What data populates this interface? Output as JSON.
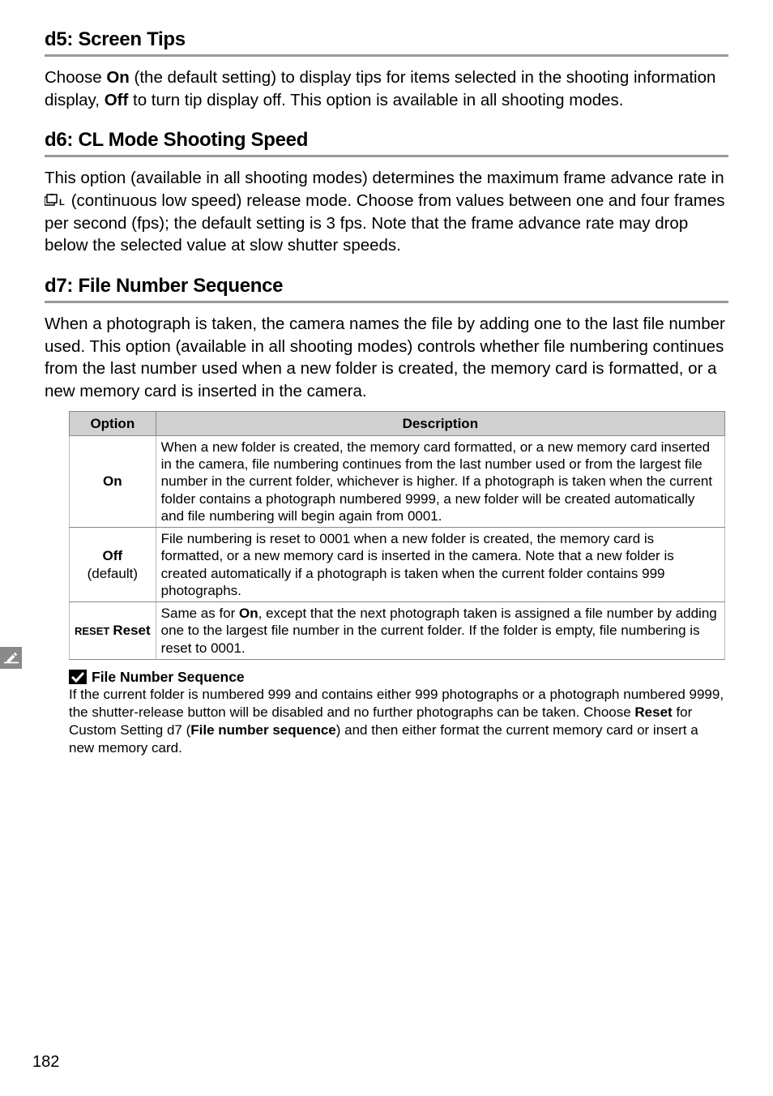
{
  "d5": {
    "heading": "d5: Screen Tips",
    "body_html": "Choose <b>On</b> (the default setting) to display tips for items selected in the shooting information display, <b>Off</b> to turn tip display off.  This option is available in all shooting modes."
  },
  "d6": {
    "heading": "d6: CL Mode Shooting Speed",
    "body_pre": "This option (available in all shooting modes) determines the maximum frame advance rate in ",
    "body_post": " (continuous low speed) release mode.  Choose from values between one and four frames per second (fps); the default setting is 3 fps.  Note that the frame advance rate may drop below the selected value at slow shutter speeds."
  },
  "d7": {
    "heading": "d7: File Number Sequence",
    "body": "When a photograph is taken, the camera names the file by adding one to the last file number used.  This option (available in all shooting modes) controls whether file numbering continues from the last number used when a new folder is created, the memory card is formatted, or a new memory card is inserted in the camera.",
    "table": {
      "col_option": "Option",
      "col_description": "Description",
      "rows": [
        {
          "option_html": "On",
          "desc": "When a new folder is created, the memory card formatted, or a new memory card inserted in the camera, file numbering continues from the last number used or from the largest file number in the current folder, whichever is higher.  If a photograph is taken when the current folder contains a photograph numbered 9999, a new folder will be created automatically and file numbering will begin again from 0001."
        },
        {
          "option_html": "<b>Off</b><br><span class=\"subnote\">(default)</span>",
          "desc": "File numbering is reset to 0001 when a new folder is created, the memory card is formatted, or a new memory card is inserted in the camera.  Note that a new folder is created automatically if a photograph is taken when the current folder contains 999 photographs."
        },
        {
          "option_html": "<span class=\"reset-prefix\">RESET</span><b>Reset</b>",
          "desc_html": "Same as for <b>On</b>, except that the next photograph taken is assigned a file number by adding one to the largest file number in the current folder.  If the folder is empty, file numbering is reset to 0001."
        }
      ]
    },
    "note": {
      "heading": "File Number Sequence",
      "body_html": "If the current folder is numbered 999 and contains either 999 photographs or a photograph numbered 9999, the shutter-release button will be disabled and no further photographs can be taken.  Choose <b>Reset</b> for Custom Setting d7 (<b>File number sequence</b>) and then either format the current memory card or insert a new memory card."
    }
  },
  "page_number": "182",
  "sidebar_icon_name": "pencil-icon"
}
